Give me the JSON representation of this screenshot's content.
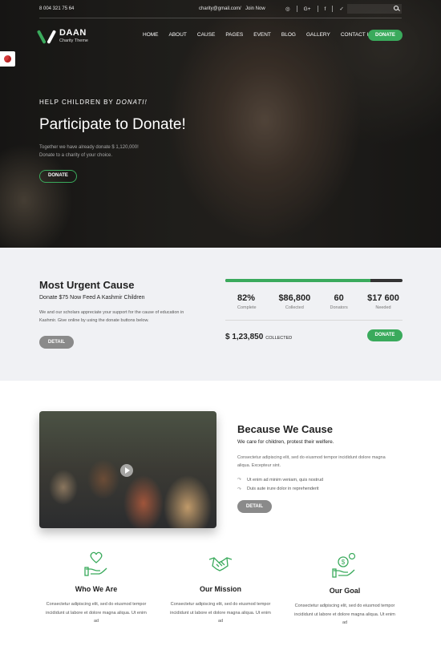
{
  "topbar": {
    "phone": "8 004 321 75 64",
    "email": "charity@gmail.com",
    "separator": "/",
    "join": "Join Now",
    "social": [
      "◎",
      "G+",
      "f",
      "✓"
    ]
  },
  "brand": {
    "name": "DAAN",
    "tagline": "Charity Theme"
  },
  "nav": {
    "items": [
      "HOME",
      "ABOUT",
      "CAUSE",
      "PAGES",
      "EVENT",
      "BLOG",
      "GALLERY",
      "CONTACT US"
    ],
    "donate": "DONATE"
  },
  "hero": {
    "tag_prefix": "HELP CHILDREN BY",
    "tag_italic": "DONATI!",
    "title": "Participate to Donate!",
    "text": "Together we have already donate $ 1,120,000! Donate to a charity of your choice.",
    "button": "DONATE"
  },
  "urgent": {
    "title": "Most Urgent Cause",
    "subtitle": "Donate $75 Now Feed A Kashmir Children",
    "description": "We and our scholars appreciate your support for the cause of education in Kashmir. Give online by using the donate buttons below.",
    "detail_button": "DETAIL",
    "progress": 0.82,
    "stats": [
      {
        "value": "82%",
        "label": "Complete"
      },
      {
        "value": "$86,800",
        "label": "Collected"
      },
      {
        "value": "60",
        "label": "Donators"
      },
      {
        "value": "$17 600",
        "label": "Needed"
      }
    ],
    "collected_amount": "$ 1,23,850",
    "collected_label": "COLLECTED",
    "donate_button": "DONATE"
  },
  "cause": {
    "title": "Because We Cause",
    "subtitle": "We care for children, protest their welfere.",
    "description": "Consectetur adipiscing elit, sed do eiusmod tempor incididunt dolore magna aliqua. Excepteur sint.",
    "list": [
      "Ut enim ad minim veniam, quis nostrud",
      "Duis aute irure dolor in reprehenderit"
    ],
    "button": "DETAIL"
  },
  "features": [
    {
      "icon": "hand-heart-icon",
      "title": "Who We Are",
      "text": "Consectetur adipiscing elit, sed do eiusmod tempor incididunt ut labore et dolore magna aliqua. Ut enim ad"
    },
    {
      "icon": "handshake-icon",
      "title": "Our Mission",
      "text": "Consectetur adipiscing elit, sed do eiusmod tempor incididunt ut labore et dolore magna aliqua. Ut enim ad"
    },
    {
      "icon": "hand-coin-icon",
      "title": "Our Goal",
      "text": "Consectetur adipiscing elit, sed do eiusmod tempor incididunt ut labore et dolore magna aliqua. Ut enim ad"
    }
  ],
  "colors": {
    "accent": "#3aaa5c",
    "dark": "#222222",
    "muted_button": "#8a8a8a",
    "section_bg": "#f0f1f4"
  }
}
